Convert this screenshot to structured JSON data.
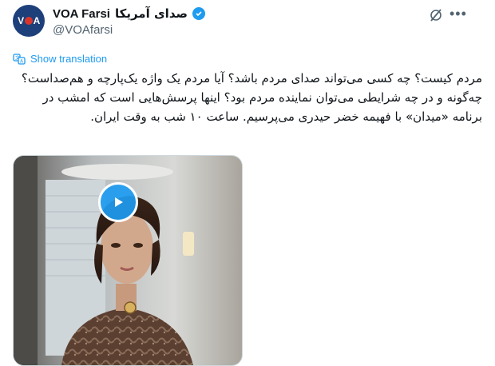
{
  "account": {
    "display_name": "VOA Farsi",
    "display_name_fa": "صدای آمریکا",
    "handle": "@VOAfarsi",
    "avatar_text": "VOA",
    "verified_icon": "verified-badge-icon"
  },
  "tweet": {
    "show_translation_label": "Show translation",
    "text": "مردم کیست؟ چه کسی می‌تواند صدای مردم باشد؟ آیا مردم یک واژه یک‌پارچه و هم‌صداست؟ چه‌گونه و در چه شرایطی می‌توان نماینده مردم بود؟ اینها پرسش‌هایی است که امشب در برنامه «میدان» با فهیمه خضر حیدری می‌پرسیم. ساعت ۱۰ شب به وقت ایران."
  },
  "colors": {
    "accent": "#1d9bf0",
    "muted_text": "#536471",
    "text": "#0f1419",
    "avatar_bg": "#1d3f7a",
    "avatar_dot": "#d7352b"
  }
}
